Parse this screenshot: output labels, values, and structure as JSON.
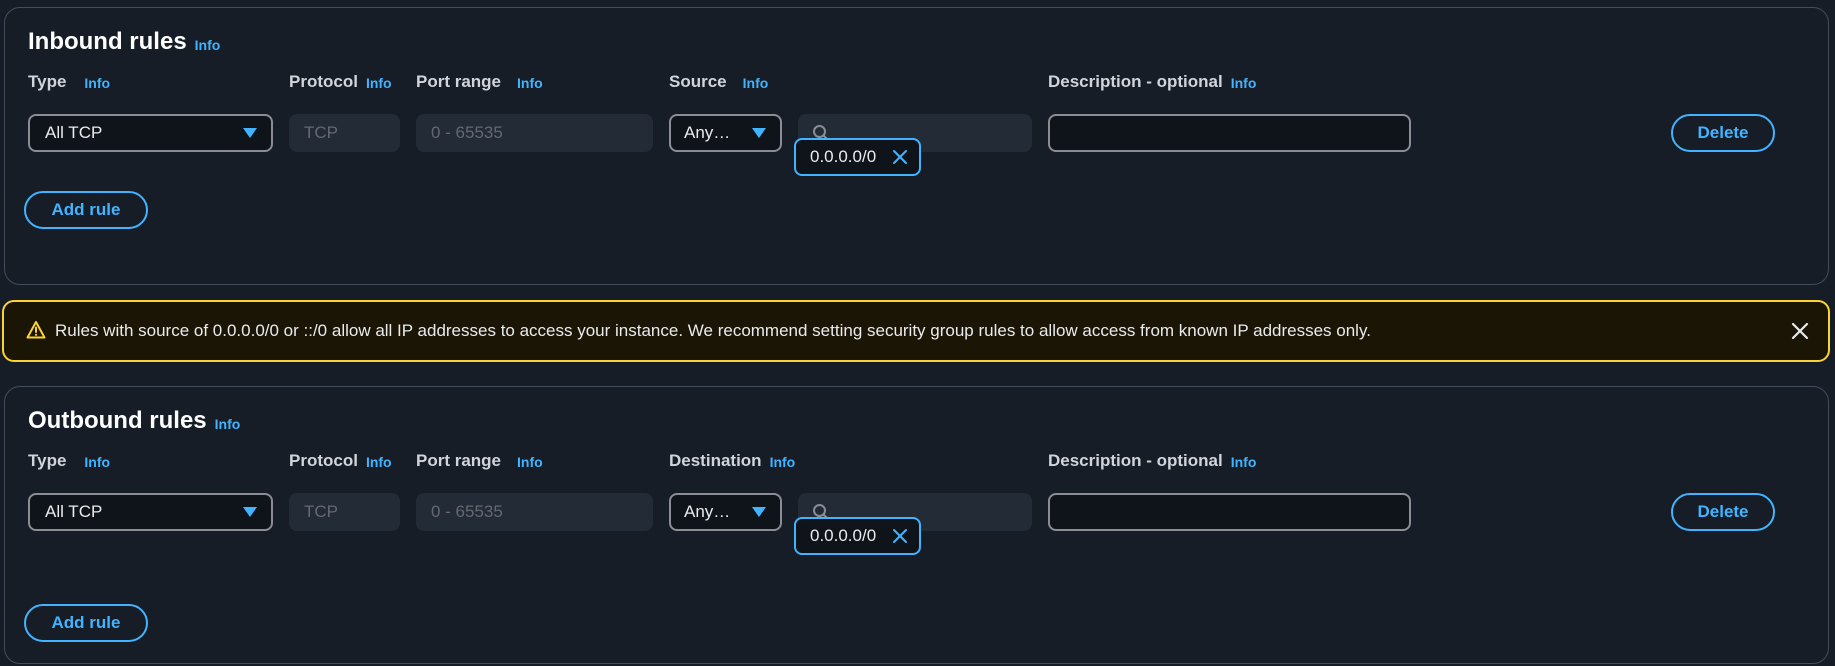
{
  "inbound": {
    "title": "Inbound rules",
    "title_info": "Info",
    "columns": {
      "type": "Type",
      "type_info": "Info",
      "protocol": "Protocol",
      "protocol_info": "Info",
      "port_range": "Port range",
      "port_range_info": "Info",
      "source": "Source",
      "source_info": "Info",
      "description": "Description - optional",
      "description_info": "Info"
    },
    "rule": {
      "type_value": "All TCP",
      "protocol_value": "TCP",
      "port_range_value": "0 - 65535",
      "source_value": "Anywh...",
      "search_placeholder": "",
      "description_value": "",
      "cidr_token": "0.0.0.0/0",
      "delete_label": "Delete"
    },
    "add_rule_label": "Add rule"
  },
  "warning": {
    "text": "Rules with source of 0.0.0.0/0 or ::/0 allow all IP addresses to access your instance. We recommend setting security group rules to allow access from known IP addresses only.",
    "icon": "warning-triangle-icon",
    "color": "#fbd332"
  },
  "outbound": {
    "title": "Outbound rules",
    "title_info": "Info",
    "columns": {
      "type": "Type",
      "type_info": "Info",
      "protocol": "Protocol",
      "protocol_info": "Info",
      "port_range": "Port range",
      "port_range_info": "Info",
      "destination": "Destination",
      "destination_info": "Info",
      "description": "Description - optional",
      "description_info": "Info"
    },
    "rule": {
      "type_value": "All TCP",
      "protocol_value": "TCP",
      "port_range_value": "0 - 65535",
      "destination_value": "Anywh...",
      "search_placeholder": "",
      "description_value": "",
      "cidr_token": "0.0.0.0/0",
      "delete_label": "Delete"
    },
    "add_rule_label": "Add rule"
  },
  "colors": {
    "accent": "#42b4ff",
    "background": "#161d26",
    "warning_border": "#fbd332"
  }
}
